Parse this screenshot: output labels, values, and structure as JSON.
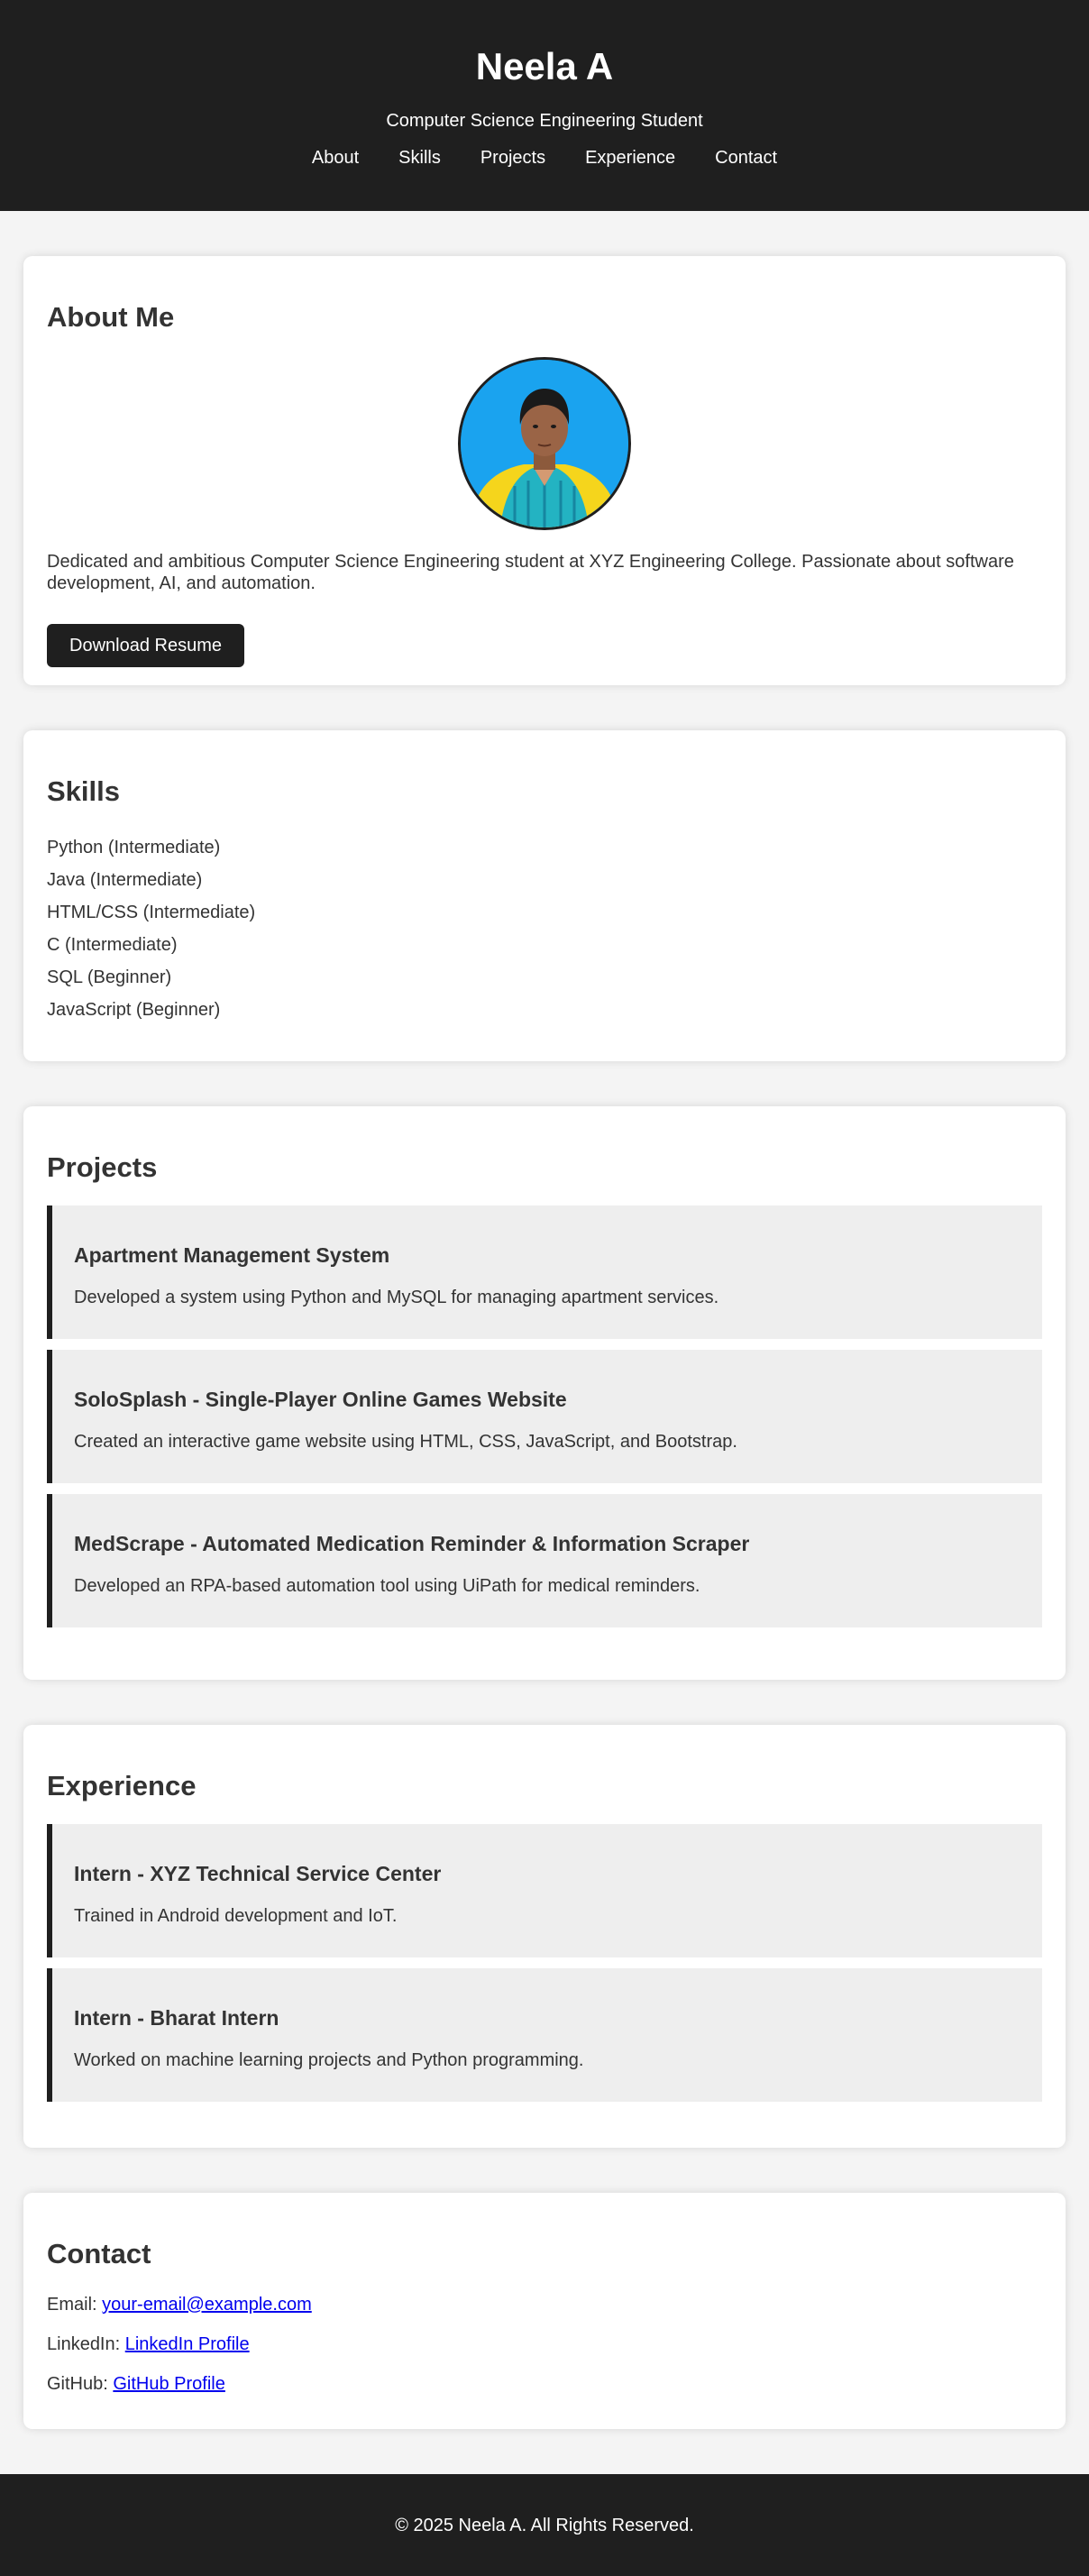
{
  "header": {
    "name": "Neela A",
    "subtitle": "Computer Science Engineering Student",
    "nav": [
      "About",
      "Skills",
      "Projects",
      "Experience",
      "Contact"
    ]
  },
  "about": {
    "title": "About Me",
    "text": "Dedicated and ambitious Computer Science Engineering student at XYZ Engineering College. Passionate about software development, AI, and automation.",
    "button": "Download Resume",
    "photo_bg": "#1aa3ef"
  },
  "skills": {
    "title": "Skills",
    "items": [
      "Python (Intermediate)",
      "Java (Intermediate)",
      "HTML/CSS (Intermediate)",
      "C (Intermediate)",
      "SQL (Beginner)",
      "JavaScript (Beginner)"
    ]
  },
  "projects": {
    "title": "Projects",
    "items": [
      {
        "title": "Apartment Management System",
        "desc": "Developed a system using Python and MySQL for managing apartment services."
      },
      {
        "title": "SoloSplash - Single-Player Online Games Website",
        "desc": "Created an interactive game website using HTML, CSS, JavaScript, and Bootstrap."
      },
      {
        "title": "MedScrape - Automated Medication Reminder & Information Scraper",
        "desc": "Developed an RPA-based automation tool using UiPath for medical reminders."
      }
    ]
  },
  "experience": {
    "title": "Experience",
    "items": [
      {
        "title": "Intern - XYZ Technical Service Center",
        "desc": "Trained in Android development and IoT."
      },
      {
        "title": "Intern - Bharat Intern",
        "desc": "Worked on machine learning projects and Python programming."
      }
    ]
  },
  "contact": {
    "title": "Contact",
    "email_label": "Email:",
    "email_link": "your-email@example.com",
    "linkedin_label": "LinkedIn:",
    "linkedin_link": "LinkedIn Profile",
    "github_label": "GitHub:",
    "github_link": "GitHub Profile"
  },
  "footer": {
    "text": "© 2025 Neela A. All Rights Reserved."
  },
  "colors": {
    "dark": "#1f1f1f",
    "page_bg": "#f4f4f4",
    "item_bg": "#eeeeee",
    "link": "#0000ee"
  }
}
